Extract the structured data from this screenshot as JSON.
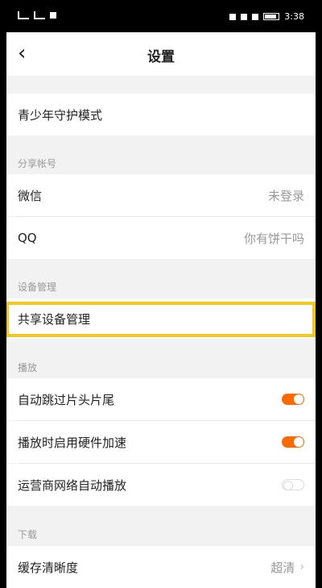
{
  "status_bar": {
    "time": "3:38"
  },
  "nav": {
    "title": "设置",
    "back_icon": "chevron-left-icon"
  },
  "teen_mode": {
    "label": "青少年守护模式"
  },
  "share_accounts": {
    "header": "分享帐号",
    "wechat": {
      "label": "微信",
      "value": "未登录"
    },
    "qq": {
      "label": "QQ",
      "value": "你有饼干吗"
    }
  },
  "device": {
    "header": "设备管理",
    "shared_device": {
      "label": "共享设备管理"
    },
    "highlight_color": "#f5c628"
  },
  "playback": {
    "header": "播放",
    "skip_intro": {
      "label": "自动跳过片头片尾",
      "on": true
    },
    "hw_accel": {
      "label": "播放时启用硬件加速",
      "on": true
    },
    "carrier_autoplay": {
      "label": "运营商网络自动播放",
      "on": false
    },
    "accent": "#ff6a00"
  },
  "download": {
    "header": "下载",
    "cache_quality": {
      "label": "缓存清晰度",
      "value": "超清"
    }
  }
}
